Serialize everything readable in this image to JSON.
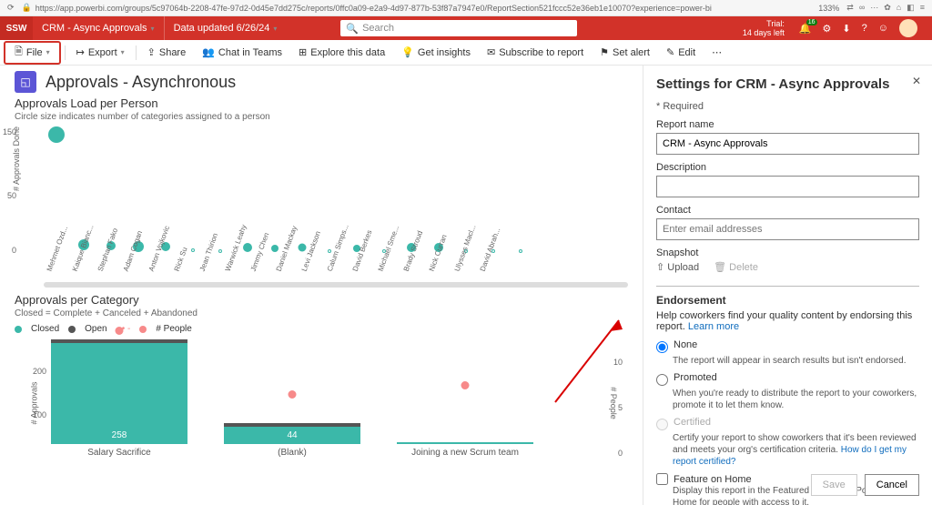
{
  "browser": {
    "url": "https://app.powerbi.com/groups/5c97064b-2208-47fe-97d2-0d45e7dd275c/reports/0ffc0a09-e2a9-4d97-877b-53f87a7947e0/ReportSection521fccc52e36eb1e10070?experience=power-bi",
    "zoom": "133%"
  },
  "appbar": {
    "brand": "SSW",
    "report_name": "CRM - Async Approvals",
    "updated": "Data updated 6/26/24",
    "search_placeholder": "Search",
    "trial_line1": "Trial:",
    "trial_line2": "14 days left",
    "notif_count": "16"
  },
  "toolbar": {
    "file": "File",
    "export": "Export",
    "share": "Share",
    "teams": "Chat in Teams",
    "explore": "Explore this data",
    "insights": "Get insights",
    "subscribe": "Subscribe to report",
    "alert": "Set alert",
    "edit": "Edit"
  },
  "report": {
    "title": "Approvals - Asynchronous",
    "section1_title": "Approvals Load per Person",
    "section1_sub": "Circle size indicates number of categories assigned to a person",
    "y_label": "# Approvals Done",
    "y_ticks": [
      "150",
      "50",
      "0"
    ],
    "section2_title": "Approvals per Category",
    "section2_sub": "Closed = Complete + Canceled + Abandoned",
    "legend_closed": "Closed",
    "legend_open": "Open",
    "legend_people": "# People",
    "bar_y_label": "# Approvals",
    "bar_y2_label": "# People",
    "bar_ticks": [
      "200",
      "100"
    ],
    "bar_ticks2": [
      "10",
      "5",
      "0"
    ]
  },
  "chart_data": [
    {
      "type": "scatter",
      "title": "Approvals Load per Person",
      "ylabel": "# Approvals Done",
      "ylim": [
        0,
        180
      ],
      "size_encodes": "number of categories assigned",
      "points": [
        {
          "name": "Mehmet Ozd...",
          "y": 170,
          "size": 18
        },
        {
          "name": "Kaique Bianc...",
          "y": 14,
          "size": 12
        },
        {
          "name": "Stephan Fako",
          "y": 13,
          "size": 10
        },
        {
          "name": "Adam Cogan",
          "y": 12,
          "size": 12
        },
        {
          "name": "Anton Vojkovic",
          "y": 11,
          "size": 10
        },
        {
          "name": "Rick Su",
          "y": 6,
          "size": 4,
          "hollow": true
        },
        {
          "name": "Jean Thirion",
          "y": 5,
          "size": 4,
          "hollow": true
        },
        {
          "name": "Warwick Leahy",
          "y": 10,
          "size": 10
        },
        {
          "name": "Jimmy Chen",
          "y": 9,
          "size": 8
        },
        {
          "name": "Daniel Mackay",
          "y": 10,
          "size": 9
        },
        {
          "name": "Levi Jackson",
          "y": 5,
          "size": 4,
          "hollow": true
        },
        {
          "name": "Calum Simps...",
          "y": 9,
          "size": 8
        },
        {
          "name": "David Berkes",
          "y": 5,
          "size": 4,
          "hollow": true
        },
        {
          "name": "Michael Sme...",
          "y": 10,
          "size": 10
        },
        {
          "name": "Brady Stroud",
          "y": 10,
          "size": 10
        },
        {
          "name": "Nick Curran",
          "y": 5,
          "size": 4,
          "hollow": true
        },
        {
          "name": "Ulysses Macl...",
          "y": 5,
          "size": 4,
          "hollow": true
        },
        {
          "name": "David Abrah...",
          "y": 5,
          "size": 4,
          "hollow": true
        }
      ]
    },
    {
      "type": "bar",
      "title": "Approvals per Category",
      "ylabel": "# Approvals",
      "y2label": "# People",
      "ylim": [
        0,
        280
      ],
      "y2lim": [
        0,
        12
      ],
      "series_stack": [
        "Closed",
        "Open"
      ],
      "series_line": "# People",
      "categories": [
        "Salary Sacrifice",
        "(Blank)",
        "Joining a new Scrum team"
      ],
      "closed": [
        258,
        44,
        5
      ],
      "open": [
        10,
        10,
        0
      ],
      "people": [
        12,
        5,
        6
      ]
    }
  ],
  "panel": {
    "heading": "Settings for CRM - Async Approvals",
    "required": "* Required",
    "report_name_label": "Report name",
    "report_name_value": "CRM - Async Approvals",
    "desc_label": "Description",
    "contact_label": "Contact",
    "contact_placeholder": "Enter email addresses",
    "snapshot_label": "Snapshot",
    "upload": "Upload",
    "delete": "Delete",
    "endorsement": "Endorsement",
    "endorse_help": "Help coworkers find your quality content by endorsing this report.",
    "learn_more": "Learn more",
    "none": "None",
    "none_desc": "The report will appear in search results but isn't endorsed.",
    "promoted": "Promoted",
    "promoted_desc": "When you're ready to distribute the report to your coworkers, promote it to let them know.",
    "certified": "Certified",
    "certified_desc": "Certify your report to show coworkers that it's been reviewed and meets your org's certification criteria.",
    "certified_link": "How do I get my report certified",
    "feature_home": "Feature on Home",
    "feature_desc": "Display this report in the Featured section on Power BI Home for people with access to it.",
    "save": "Save",
    "cancel": "Cancel"
  }
}
